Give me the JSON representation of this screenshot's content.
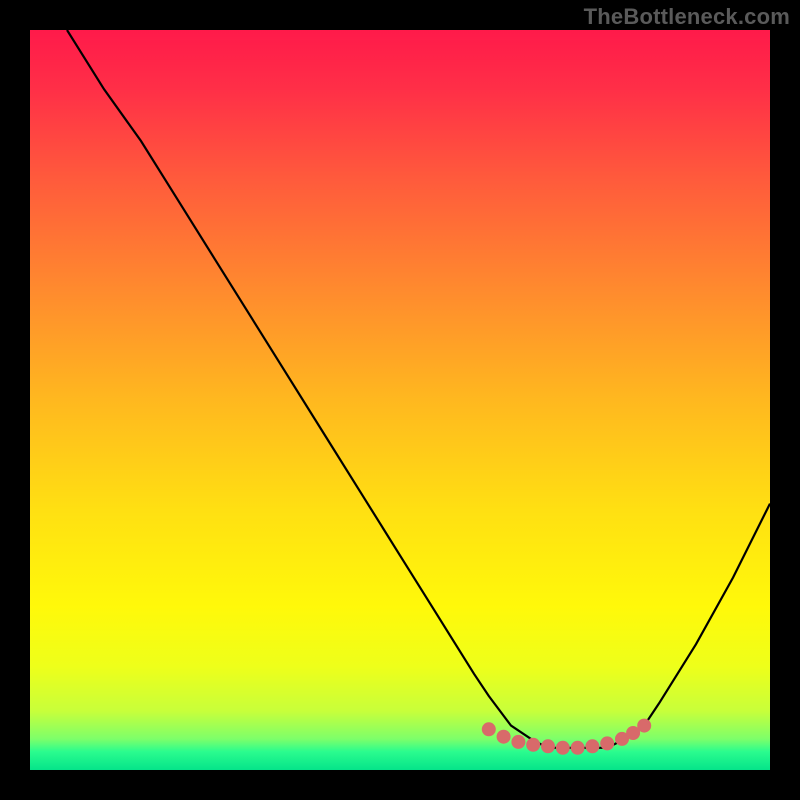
{
  "attribution": "TheBottleneck.com",
  "gradient_stops": [
    {
      "offset": 0.0,
      "color": "#ff1a4a"
    },
    {
      "offset": 0.08,
      "color": "#ff2f47"
    },
    {
      "offset": 0.2,
      "color": "#ff5a3c"
    },
    {
      "offset": 0.35,
      "color": "#ff8a2e"
    },
    {
      "offset": 0.5,
      "color": "#ffb81f"
    },
    {
      "offset": 0.65,
      "color": "#ffe012"
    },
    {
      "offset": 0.78,
      "color": "#fff90a"
    },
    {
      "offset": 0.86,
      "color": "#eeff1a"
    },
    {
      "offset": 0.92,
      "color": "#c8ff3a"
    },
    {
      "offset": 0.958,
      "color": "#7dff6a"
    },
    {
      "offset": 0.975,
      "color": "#2bfc8e"
    },
    {
      "offset": 1.0,
      "color": "#05e48a"
    }
  ],
  "chart_data": {
    "type": "line",
    "title": "",
    "xlabel": "",
    "ylabel": "",
    "xlim": [
      0,
      100
    ],
    "ylim": [
      0,
      100
    ],
    "series": [
      {
        "name": "bottleneck-curve",
        "x": [
          5,
          10,
          15,
          20,
          25,
          30,
          35,
          40,
          45,
          50,
          55,
          60,
          62,
          65,
          68,
          70,
          73,
          75,
          78,
          80,
          83,
          85,
          90,
          95,
          100
        ],
        "y": [
          100,
          92,
          85,
          77,
          69,
          61,
          53,
          45,
          37,
          29,
          21,
          13,
          10,
          6,
          4,
          3,
          3,
          3,
          3,
          4,
          6,
          9,
          17,
          26,
          36
        ]
      }
    ],
    "markers": {
      "name": "optimal-zone-dots",
      "color": "#d86a6a",
      "x": [
        62,
        64,
        66,
        68,
        70,
        72,
        74,
        76,
        78,
        80,
        81.5,
        83
      ],
      "y": [
        5.5,
        4.5,
        3.8,
        3.4,
        3.2,
        3.0,
        3.0,
        3.2,
        3.6,
        4.2,
        5.0,
        6.0
      ]
    }
  }
}
